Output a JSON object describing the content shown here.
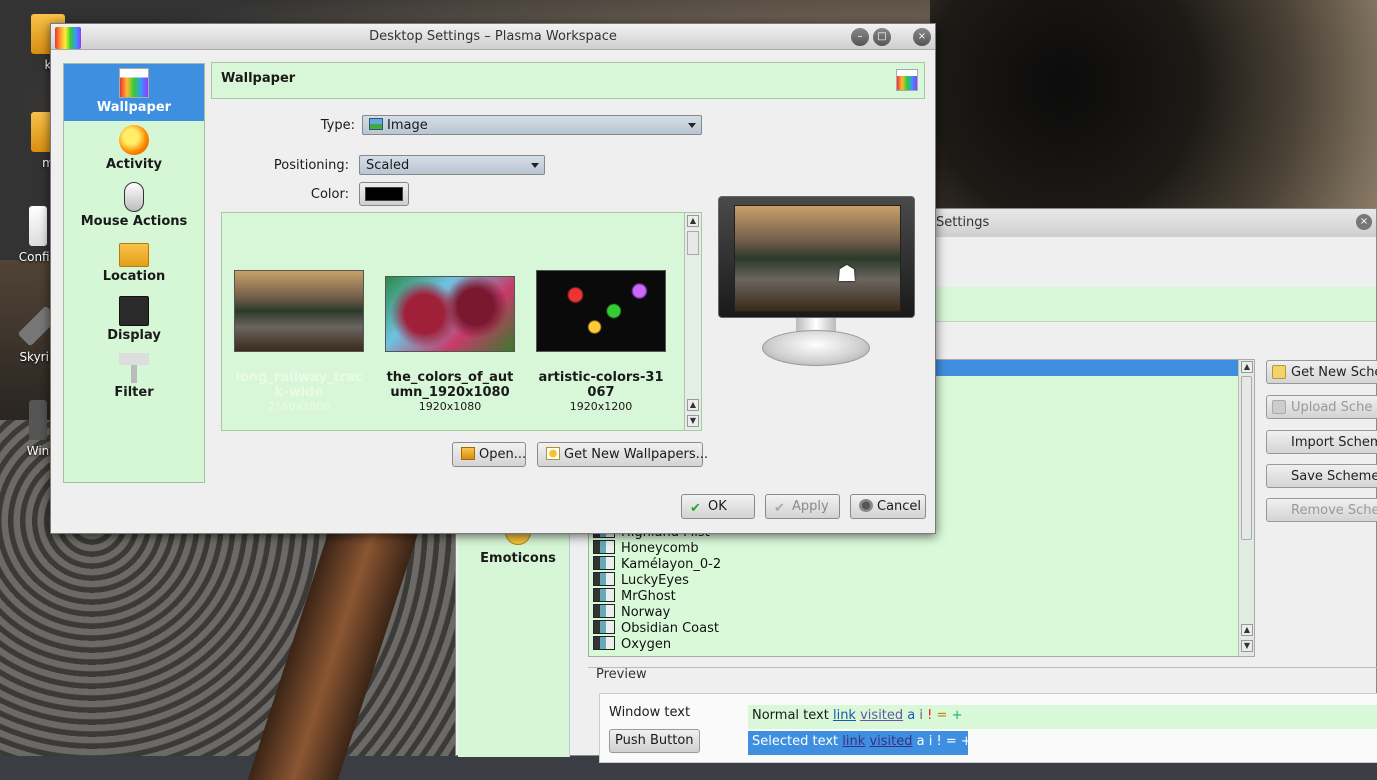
{
  "desktop": {
    "icons": [
      {
        "label": "k"
      },
      {
        "label": "m"
      },
      {
        "label": "Config"
      },
      {
        "label": "Skyrin"
      },
      {
        "label": "Win"
      }
    ]
  },
  "back_window": {
    "title_fragment": "Settings",
    "schemes": [
      "Highland Mist",
      "Honeycomb",
      "Kamélayon_0-2",
      "LuckyEyes",
      "MrGhost",
      "Norway",
      "Obsidian Coast",
      "Oxygen"
    ],
    "buttons": [
      {
        "label": "Get New Sche",
        "enabled": true
      },
      {
        "label": "Upload Sche",
        "enabled": false
      },
      {
        "label": "Import Schem",
        "enabled": true
      },
      {
        "label": "Save Scheme",
        "enabled": true
      },
      {
        "label": "Remove Schem",
        "enabled": false
      }
    ],
    "sidebar_emoticons": "Emoticons",
    "preview": {
      "group_label": "Preview",
      "window_text": "Window text",
      "push_button": "Push Button",
      "normal": {
        "text": "Normal text",
        "link": "link",
        "visited": "visited",
        "a": "a",
        "i": "i",
        "bang": "!",
        "eq": "=",
        "plus": "+"
      },
      "selected": {
        "text": "Selected text",
        "link": "link",
        "visited": "visited",
        "a": "a",
        "i": "i",
        "bang": "!",
        "eq": "=",
        "plus": "+"
      }
    }
  },
  "dialog": {
    "title": "Desktop Settings – Plasma Workspace",
    "window_buttons": {
      "minimize": "–",
      "maximize": "□",
      "close": "×"
    },
    "sidebar": [
      {
        "label": "Wallpaper",
        "icon": "wallpaper-icon",
        "active": true
      },
      {
        "label": "Activity",
        "icon": "activity-icon",
        "active": false
      },
      {
        "label": "Mouse Actions",
        "icon": "mouse-icon",
        "active": false
      },
      {
        "label": "Location",
        "icon": "folder-icon",
        "active": false
      },
      {
        "label": "Display",
        "icon": "display-icon",
        "active": false
      },
      {
        "label": "Filter",
        "icon": "filter-icon",
        "active": false
      }
    ],
    "header": {
      "title": "Wallpaper"
    },
    "type": {
      "label": "Type:",
      "value": "Image"
    },
    "positioning": {
      "label": "Positioning:",
      "value": "Scaled"
    },
    "color": {
      "label": "Color:",
      "value": "#000000"
    },
    "wallpapers": [
      {
        "name": "long_railway_track-wide",
        "size": "2560x1600",
        "selected": true
      },
      {
        "name": "the_colors_of_autumn_1920x1080",
        "size": "1920x1080",
        "selected": false
      },
      {
        "name": "artistic-colors-31067",
        "size": "1920x1200",
        "selected": false
      }
    ],
    "buttons": {
      "open": "Open...",
      "get_new": "Get New Wallpapers...",
      "ok": "OK",
      "apply": "Apply",
      "cancel": "Cancel"
    },
    "colors": {
      "accent": "#3f8fe0",
      "panel_green": "#d8f7d8"
    }
  }
}
